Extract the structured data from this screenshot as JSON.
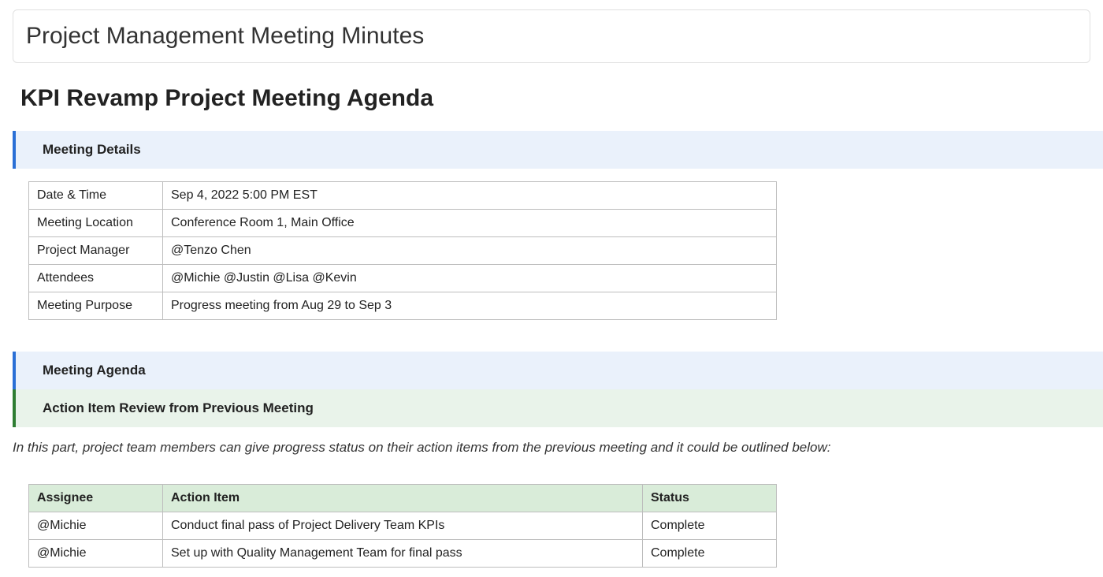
{
  "page_title": "Project Management Meeting Minutes",
  "agenda_title": "KPI Revamp Project Meeting Agenda",
  "section_headers": {
    "meeting_details": "Meeting Details",
    "meeting_agenda": "Meeting Agenda",
    "action_item_review": "Action Item Review from Previous Meeting"
  },
  "details": {
    "rows": [
      {
        "label": "Date & Time",
        "value": "Sep 4, 2022 5:00 PM EST"
      },
      {
        "label": "Meeting Location",
        "value": "Conference Room 1, Main Office"
      },
      {
        "label": "Project Manager",
        "value": "@Tenzo Chen"
      },
      {
        "label": "Attendees",
        "value": "@Michie @Justin @Lisa @Kevin"
      },
      {
        "label": "Meeting Purpose",
        "value": "Progress meeting from Aug 29 to Sep 3"
      }
    ]
  },
  "review_note": "In this part, project team members can give progress status on their action items from the previous meeting and it could be outlined below:",
  "action_items": {
    "headers": {
      "assignee": "Assignee",
      "item": "Action Item",
      "status": "Status"
    },
    "rows": [
      {
        "assignee": "@Michie",
        "item": "Conduct final pass of Project Delivery Team KPIs",
        "status": "Complete"
      },
      {
        "assignee": "@Michie",
        "item": "Set up with Quality Management Team for final pass",
        "status": "Complete"
      }
    ]
  }
}
